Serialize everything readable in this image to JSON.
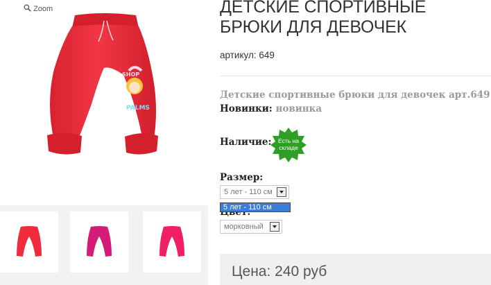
{
  "gallery": {
    "zoom_label": "Zoom",
    "thumb_colors": [
      "#ef2b3c",
      "#d51a78",
      "#f01e62"
    ],
    "main_color": "#ef2b3c",
    "print_text": "PALMS"
  },
  "product": {
    "title": "ДЕТСКИЕ СПОРТИВНЫЕ БРЮКИ ДЛЯ ДЕВОЧЕК",
    "sku_label": "артикул:",
    "sku_value": "649",
    "description": "Детские спортивные брюки для девочек арт.649",
    "new_label": "Новинки:",
    "new_value": "новинка",
    "availability_label": "Наличие:",
    "availability_badge_line1": "Есть на",
    "availability_badge_line2": "складе",
    "badge_color": "#2e9e24",
    "size_label": "Размер:",
    "size_value": "5 лет - 110 см",
    "size_options": [
      "5 лет - 110 см"
    ],
    "color_label": "Цвет:",
    "color_value": "морковный",
    "price": "Цена: 240 руб"
  }
}
